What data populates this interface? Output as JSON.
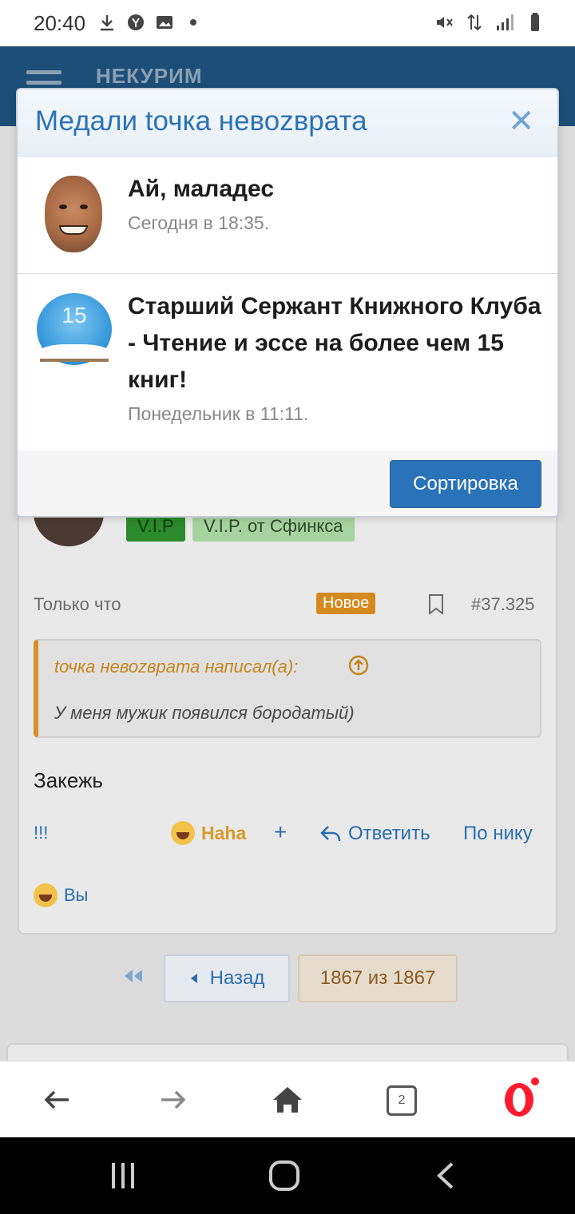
{
  "status_bar": {
    "time": "20:40"
  },
  "site": {
    "logo": "НЕКУРИМ"
  },
  "modal": {
    "title": "Медали tочка невоzврата",
    "medals": [
      {
        "name": "Ай, маладес",
        "date": "Сегодня в 18:35."
      },
      {
        "name": "Старший Сержант Книжного Клуба - Чтение и эссе на более чем 15 книг!",
        "date": "Понедельник в 11:11.",
        "badge_number": "15"
      }
    ],
    "sort_button": "Сортировка"
  },
  "post": {
    "badges": [
      "V.I.P",
      "V.I.P. от Сфинкса"
    ],
    "time": "Только что",
    "new_label": "Новое",
    "number": "#37.325",
    "quote": {
      "author": "tочка невоzврата написал(а):",
      "text": "У меня мужик появился бородатый)"
    },
    "text": "Закежь",
    "actions": {
      "exclaim": "!!!",
      "reaction": "Haha",
      "plus": "+",
      "reply": "Ответить",
      "by_nick": "По нику"
    },
    "reacted_by": "Вы"
  },
  "pager": {
    "back": "Назад",
    "page": "1867 из 1867"
  },
  "browser": {
    "tabs_count": "2"
  }
}
